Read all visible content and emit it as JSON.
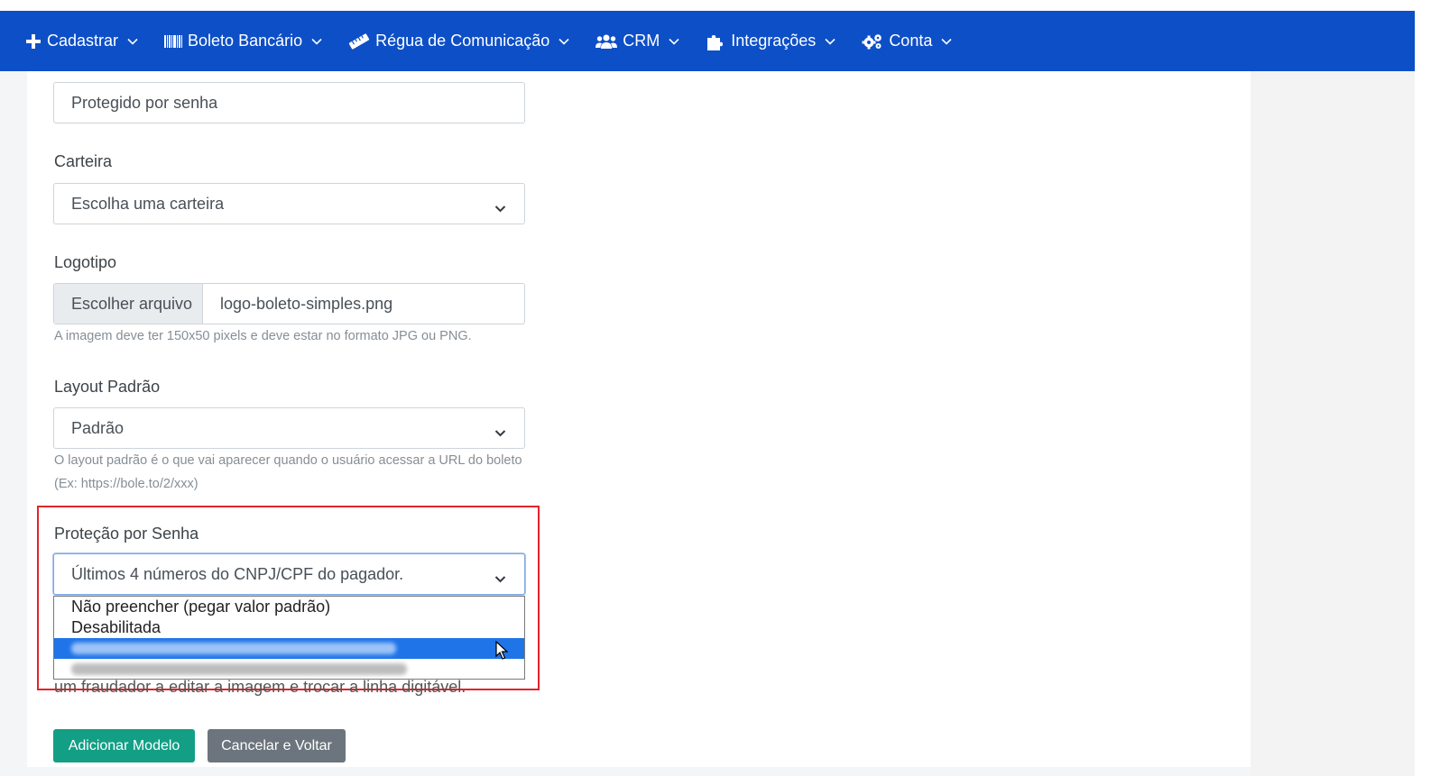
{
  "navbar": {
    "items": [
      {
        "label": "Cadastrar",
        "icon": "plus-icon"
      },
      {
        "label": "Boleto Bancário",
        "icon": "barcode-icon"
      },
      {
        "label": "Régua de Comunicação",
        "icon": "ruler-icon"
      },
      {
        "label": "CRM",
        "icon": "users-icon"
      },
      {
        "label": "Integrações",
        "icon": "puzzle-icon"
      },
      {
        "label": "Conta",
        "icon": "gears-icon"
      }
    ]
  },
  "form": {
    "name_field": {
      "value": "Protegido por senha"
    },
    "carteira": {
      "label": "Carteira",
      "value": "Escolha uma carteira"
    },
    "logotipo": {
      "label": "Logotipo",
      "button_label": "Escolher arquivo",
      "file_name": "logo-boleto-simples.png",
      "hint": "A imagem deve ter 150x50 pixels e deve estar no formato JPG ou PNG."
    },
    "layout": {
      "label": "Layout Padrão",
      "value": "Padrão",
      "hint_line1": "O layout padrão é o que vai aparecer quando o usuário acessar a URL do boleto",
      "hint_line2": "(Ex: https://bole.to/2/xxx)"
    },
    "password_protection": {
      "label": "Proteção por Senha",
      "value": "Últimos 4 números do CNPJ/CPF do pagador.",
      "options": [
        "Não preencher (pegar valor padrão)",
        "Desabilitada"
      ],
      "hint_partial": "um fraudador a editar a imagem e trocar a linha digitável."
    },
    "buttons": {
      "submit": "Adicionar Modelo",
      "cancel": "Cancelar e Voltar"
    }
  },
  "colors": {
    "navbar": "#0d4fc7",
    "primary_button": "#139f85",
    "secondary_button": "#6c757d",
    "highlight_border": "#e3242b",
    "option_selected": "#1f74e8"
  }
}
